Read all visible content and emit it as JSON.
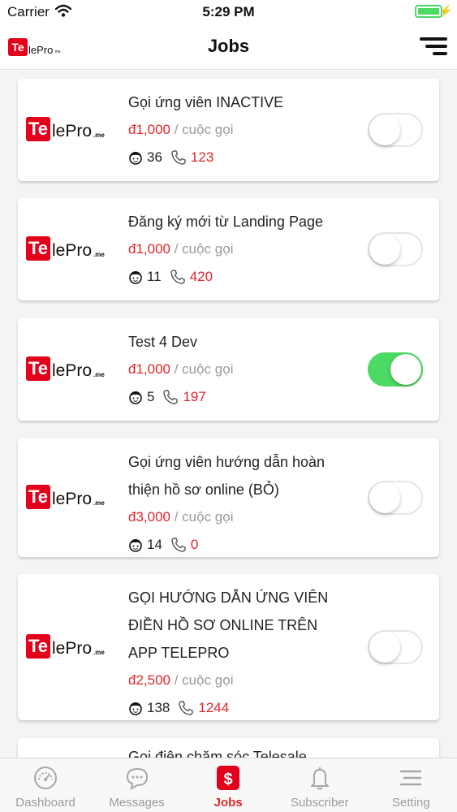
{
  "status_bar": {
    "carrier": "Carrier",
    "time": "5:29 PM"
  },
  "nav": {
    "title": "Jobs",
    "logo": {
      "badge": "Te",
      "text": "lePro",
      "suffix": ".me"
    }
  },
  "card_logo": {
    "badge": "Te",
    "text": "lePro",
    "suffix": ".me"
  },
  "jobs": [
    {
      "title_lines": [
        "Gọi ứng viên INACTIVE"
      ],
      "price": "đ1,000",
      "unit": " / cuộc gọi",
      "agents": "36",
      "calls": "123",
      "active": false
    },
    {
      "title_lines": [
        "Đăng ký mới từ Landing Page"
      ],
      "price": "đ1,000",
      "unit": " / cuộc gọi",
      "agents": "11",
      "calls": "420",
      "active": false
    },
    {
      "title_lines": [
        "Test 4 Dev"
      ],
      "price": "đ1,000",
      "unit": " / cuộc gọi",
      "agents": "5",
      "calls": "197",
      "active": true
    },
    {
      "title_lines": [
        "Gọi ứng viên hướng dẫn hoàn",
        "thiện hồ sơ online (BỎ)"
      ],
      "price": "đ3,000",
      "unit": " / cuộc gọi",
      "agents": "14",
      "calls": "0",
      "active": false
    },
    {
      "title_lines": [
        "GỌI HƯỚNG DẪN ỨNG VIÊN",
        "ĐIỀN HỒ SƠ ONLINE TRÊN",
        "APP TELEPRO"
      ],
      "price": "đ2,500",
      "unit": " / cuộc gọi",
      "agents": "138",
      "calls": "1244",
      "active": false
    },
    {
      "title_lines": [
        "Gọi điện chăm sóc Telesale"
      ],
      "price": "",
      "unit": "",
      "agents": "",
      "calls": "",
      "active": false
    }
  ],
  "tabs": [
    {
      "label": "Dashboard",
      "icon": "gauge-icon",
      "active": false
    },
    {
      "label": "Messages",
      "icon": "chat-icon",
      "active": false
    },
    {
      "label": "Jobs",
      "icon": "dollar-icon",
      "active": true
    },
    {
      "label": "Subscriber",
      "icon": "bell-icon",
      "active": false
    },
    {
      "label": "Setting",
      "icon": "menu-icon",
      "active": false
    }
  ],
  "colors": {
    "accent": "#e0262b",
    "toggle_on": "#4cd964",
    "muted": "#9b9b9b",
    "logo_red": "#e3001b"
  }
}
